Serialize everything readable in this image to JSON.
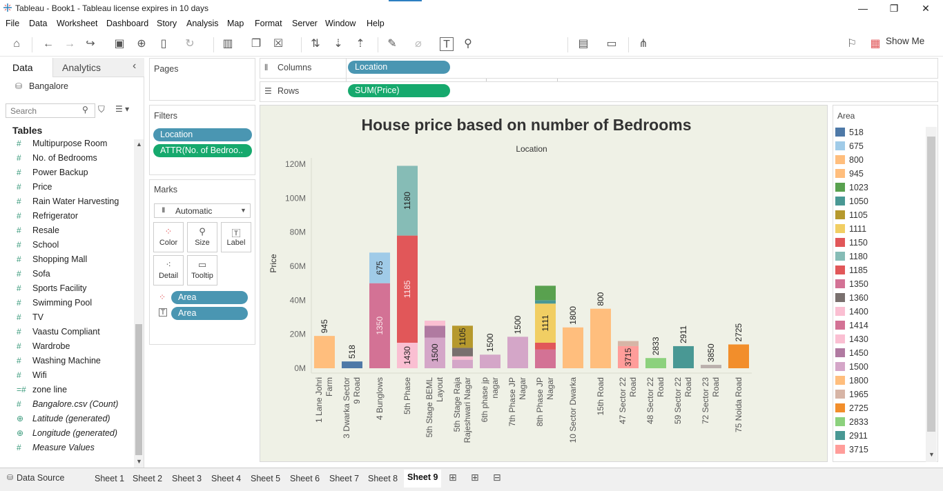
{
  "app": {
    "title": "Tableau - Book1 - Tableau license expires in 10 days",
    "minimize": "—",
    "restore": "❐",
    "close": "✕"
  },
  "menu": [
    "File",
    "Data",
    "Worksheet",
    "Dashboard",
    "Story",
    "Analysis",
    "Map",
    "Format",
    "Server",
    "Window",
    "Help"
  ],
  "toolbar": {
    "fit_value": "Standard",
    "show_me_label": "Show Me"
  },
  "data_pane": {
    "tab_data": "Data",
    "tab_analytics": "Analytics",
    "collapse": "‹",
    "datasource": "Bangalore",
    "search_placeholder": "Search",
    "tables_heading": "Tables",
    "fields": [
      {
        "label": "Multipurpose Room",
        "icon": "#"
      },
      {
        "label": "No. of Bedrooms",
        "icon": "#"
      },
      {
        "label": "Power Backup",
        "icon": "#"
      },
      {
        "label": "Price",
        "icon": "#"
      },
      {
        "label": "Rain Water Harvesting",
        "icon": "#"
      },
      {
        "label": "Refrigerator",
        "icon": "#"
      },
      {
        "label": "Resale",
        "icon": "#"
      },
      {
        "label": "School",
        "icon": "#"
      },
      {
        "label": "Shopping Mall",
        "icon": "#"
      },
      {
        "label": "Sofa",
        "icon": "#"
      },
      {
        "label": "Sports Facility",
        "icon": "#"
      },
      {
        "label": "Swimming Pool",
        "icon": "#"
      },
      {
        "label": "TV",
        "icon": "#"
      },
      {
        "label": "Vaastu Compliant",
        "icon": "#"
      },
      {
        "label": "Wardrobe",
        "icon": "#"
      },
      {
        "label": "Washing Machine",
        "icon": "#"
      },
      {
        "label": "Wifi",
        "icon": "#"
      },
      {
        "label": "zone line",
        "icon": "=#"
      },
      {
        "label": "Bangalore.csv (Count)",
        "icon": "#",
        "italic": true
      },
      {
        "label": "Latitude (generated)",
        "icon": "⊕",
        "italic": true
      },
      {
        "label": "Longitude (generated)",
        "icon": "⊕",
        "italic": true
      },
      {
        "label": "Measure Values",
        "icon": "#",
        "italic": true
      }
    ]
  },
  "shelves": {
    "pages_title": "Pages",
    "filters_title": "Filters",
    "filters": [
      "Location",
      "ATTR(No. of Bedroo.."
    ],
    "marks_title": "Marks",
    "mark_type": "Automatic",
    "mark_buttons": [
      "Color",
      "Size",
      "Label",
      "Detail",
      "Tooltip"
    ],
    "mark_fields": [
      "Area",
      "Area"
    ],
    "columns_label": "Columns",
    "columns_pill": "Location",
    "rows_label": "Rows",
    "rows_pill": "SUM(Price)"
  },
  "legend": {
    "title": "Area",
    "items": [
      {
        "label": "518",
        "color": "#4e79a7"
      },
      {
        "label": "675",
        "color": "#a0cbe8"
      },
      {
        "label": "800",
        "color": "#ffbe7d"
      },
      {
        "label": "945",
        "color": "#ffbe7d"
      },
      {
        "label": "1023",
        "color": "#59a14f"
      },
      {
        "label": "1050",
        "color": "#499894"
      },
      {
        "label": "1105",
        "color": "#b6992d"
      },
      {
        "label": "1111",
        "color": "#f1ce63"
      },
      {
        "label": "1150",
        "color": "#e15759"
      },
      {
        "label": "1180",
        "color": "#86bcb6"
      },
      {
        "label": "1185",
        "color": "#e15759"
      },
      {
        "label": "1350",
        "color": "#d37295"
      },
      {
        "label": "1360",
        "color": "#79706e"
      },
      {
        "label": "1400",
        "color": "#fabfd2"
      },
      {
        "label": "1414",
        "color": "#d37295"
      },
      {
        "label": "1430",
        "color": "#fabfd2"
      },
      {
        "label": "1450",
        "color": "#b07aa1"
      },
      {
        "label": "1500",
        "color": "#d4a6c8"
      },
      {
        "label": "1800",
        "color": "#ffbe7d"
      },
      {
        "label": "1965",
        "color": "#d7b5a6"
      },
      {
        "label": "2725",
        "color": "#f28e2b"
      },
      {
        "label": "2833",
        "color": "#8cd17d"
      },
      {
        "label": "2911",
        "color": "#499894"
      },
      {
        "label": "3715",
        "color": "#ff9d9a"
      }
    ]
  },
  "chart_data": {
    "type": "bar",
    "title": "House price based on number of Bedrooms",
    "xlabel": "Location",
    "ylabel": "Price",
    "ylim": [
      0,
      120000000
    ],
    "yticks": [
      "0M",
      "20M",
      "40M",
      "60M",
      "80M",
      "100M",
      "120M"
    ],
    "grid": false,
    "legend_placement": "right",
    "categories": [
      "1 Lane Johri Farm",
      "3 Dwarka Sector 9 Road",
      "4 Bunglows",
      "5th Phase",
      "5th Stage BEML Layout",
      "5th Stage Raja Rajeshwari Nagar",
      "6th phase jp nagar",
      "7th Phase JP Nagar",
      "8th Phase JP Nagar",
      "10 Sector Dwarka",
      "15th Road",
      "47 Sector 22 Road",
      "48 Sector 22 Road",
      "59 Sector 22 Road",
      "72 Sector 23 Road",
      "75 Noida Road"
    ],
    "stacks": [
      [
        {
          "area": "945",
          "value": 19000000,
          "color": "#ffbe7d",
          "label": "945",
          "label_pos": "above"
        }
      ],
      [
        {
          "area": "518",
          "value": 4000000,
          "color": "#4e79a7",
          "label": "518",
          "label_pos": "above"
        }
      ],
      [
        {
          "area": "1350",
          "value": 50000000,
          "color": "#d37295",
          "label": "1350",
          "label_pos": "inside"
        },
        {
          "area": "675",
          "value": 18000000,
          "color": "#a0cbe8",
          "label": "675",
          "label_pos": "inside"
        }
      ],
      [
        {
          "area": "1430",
          "value": 15000000,
          "color": "#fabfd2",
          "label": "1430",
          "label_pos": "inside"
        },
        {
          "area": "1185",
          "value": 63000000,
          "color": "#e15759",
          "label": "1185",
          "label_pos": "inside"
        },
        {
          "area": "1180",
          "value": 41000000,
          "color": "#86bcb6",
          "label": "1180",
          "label_pos": "inside"
        }
      ],
      [
        {
          "area": "1500",
          "value": 18000000,
          "color": "#d4a6c8",
          "label": "1500",
          "label_pos": "inside"
        },
        {
          "area": "1450",
          "value": 7000000,
          "color": "#b07aa1",
          "label": "",
          "label_pos": "none"
        },
        {
          "area": "1430",
          "value": 3000000,
          "color": "#fabfd2",
          "label": "",
          "label_pos": "none"
        }
      ],
      [
        {
          "area": "1500",
          "value": 5000000,
          "color": "#d4a6c8",
          "label": "",
          "label_pos": "none"
        },
        {
          "area": "1400",
          "value": 2000000,
          "color": "#fabfd2",
          "label": "",
          "label_pos": "none"
        },
        {
          "area": "1360",
          "value": 5000000,
          "color": "#79706e",
          "label": "",
          "label_pos": "none"
        },
        {
          "area": "1105",
          "value": 13000000,
          "color": "#b6992d",
          "label": "1105",
          "label_pos": "inside"
        }
      ],
      [
        {
          "area": "1500",
          "value": 8000000,
          "color": "#d4a6c8",
          "label": "1500",
          "label_pos": "above"
        }
      ],
      [
        {
          "area": "1500",
          "value": 18500000,
          "color": "#d4a6c8",
          "label": "1500",
          "label_pos": "above"
        }
      ],
      [
        {
          "area": "1414",
          "value": 11000000,
          "color": "#d37295",
          "label": "",
          "label_pos": "none"
        },
        {
          "area": "1150",
          "value": 4000000,
          "color": "#e15759",
          "label": "",
          "label_pos": "none"
        },
        {
          "area": "1111",
          "value": 23000000,
          "color": "#f1ce63",
          "label": "1111",
          "label_pos": "inside"
        },
        {
          "area": "1050",
          "value": 2000000,
          "color": "#499894",
          "label": "",
          "label_pos": "none"
        },
        {
          "area": "1023",
          "value": 8500000,
          "color": "#59a14f",
          "label": "",
          "label_pos": "none"
        }
      ],
      [
        {
          "area": "1800",
          "value": 24000000,
          "color": "#ffbe7d",
          "label": "1800",
          "label_pos": "above"
        }
      ],
      [
        {
          "area": "800",
          "value": 35000000,
          "color": "#ffbe7d",
          "label": "800",
          "label_pos": "above"
        }
      ],
      [
        {
          "area": "3715",
          "value": 13000000,
          "color": "#ff9d9a",
          "label": "3715",
          "label_pos": "inside"
        },
        {
          "area": "1965",
          "value": 3000000,
          "color": "#d7b5a6",
          "label": "",
          "label_pos": "none"
        }
      ],
      [
        {
          "area": "2833",
          "value": 6000000,
          "color": "#8cd17d",
          "label": "2833",
          "label_pos": "above"
        }
      ],
      [
        {
          "area": "2911",
          "value": 13000000,
          "color": "#499894",
          "label": "2911",
          "label_pos": "above"
        }
      ],
      [
        {
          "area": "3850",
          "value": 2000000,
          "color": "#bab0ac",
          "label": "3850",
          "label_pos": "above"
        }
      ],
      [
        {
          "area": "2725",
          "value": 14000000,
          "color": "#f28e2b",
          "label": "2725",
          "label_pos": "above"
        }
      ]
    ]
  },
  "sheets": {
    "data_source": "Data Source",
    "tabs": [
      "Sheet 1",
      "Sheet 2",
      "Sheet 3",
      "Sheet 4",
      "Sheet 5",
      "Sheet 6",
      "Sheet 7",
      "Sheet 8",
      "Sheet 9"
    ],
    "active": "Sheet 9"
  }
}
